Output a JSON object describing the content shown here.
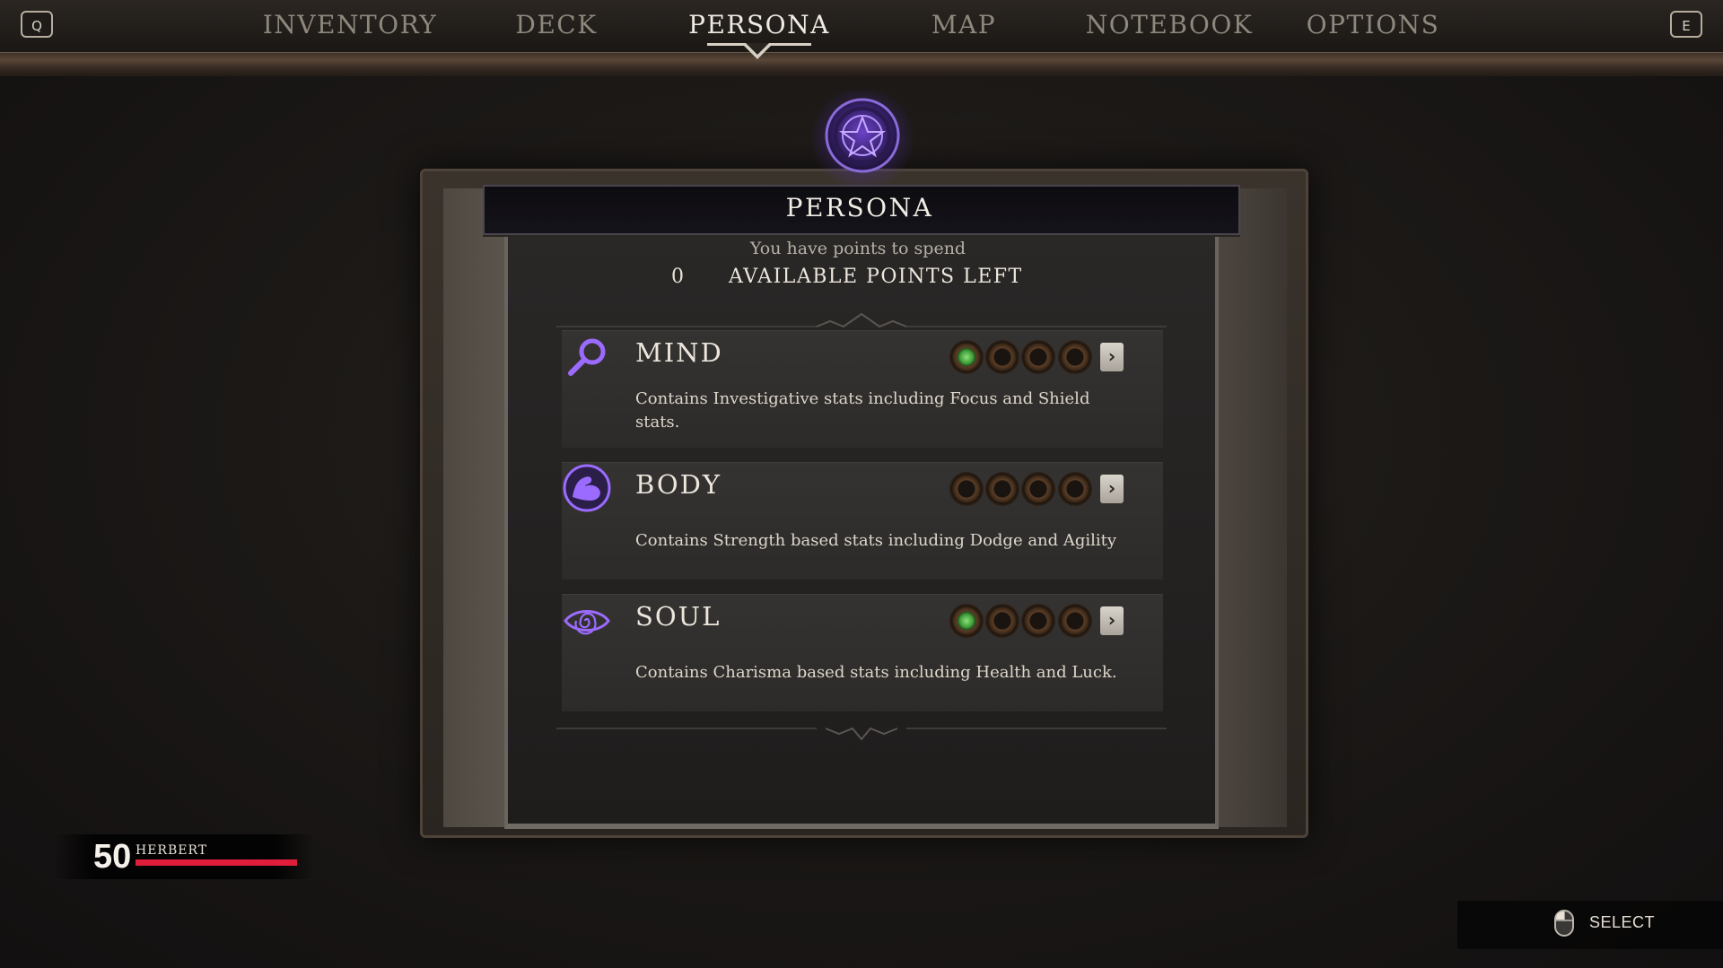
{
  "nav": {
    "prev_key": "Q",
    "next_key": "E",
    "tabs": [
      {
        "label": "INVENTORY"
      },
      {
        "label": "DECK"
      },
      {
        "label": "PERSONA"
      },
      {
        "label": "MAP"
      },
      {
        "label": "NOTEBOOK"
      },
      {
        "label": "OPTIONS"
      }
    ],
    "active_tab": "PERSONA"
  },
  "panel": {
    "title": "PERSONA",
    "points_caption": "You have points to spend",
    "points_value": "0",
    "points_label": "AVAILABLE POINTS LEFT"
  },
  "stats": [
    {
      "name": "MIND",
      "icon": "magnifying-glass-icon",
      "description": "Contains Investigative stats including Focus and Shield stats.",
      "level": 1,
      "max_level": 4
    },
    {
      "name": "BODY",
      "icon": "flexed-arm-icon",
      "description": "Contains Strength based stats including Dodge and Agility",
      "level": 0,
      "max_level": 4
    },
    {
      "name": "SOUL",
      "icon": "spiral-eye-icon",
      "description": "Contains Charisma based stats including Health and Luck.",
      "level": 1,
      "max_level": 4
    }
  ],
  "hud": {
    "level": "50",
    "character_name": "HERBERT",
    "health_fraction": 1.0
  },
  "prompt": {
    "icon": "mouse-icon",
    "label": "SELECT"
  },
  "colors": {
    "accent_purple": "#8a5cf0",
    "pip_filled": "#4caf3c",
    "health_bar": "#e01e3c"
  }
}
